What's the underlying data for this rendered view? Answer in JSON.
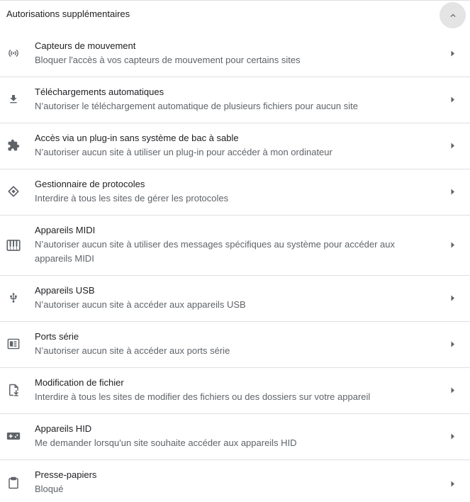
{
  "section": {
    "title": "Autorisations supplémentaires",
    "collapse_icon": "chevron-up-icon"
  },
  "rows": [
    {
      "icon": "sensors-icon",
      "title": "Capteurs de mouvement",
      "subtitle": "Bloquer l'accès à vos capteurs de mouvement pour certains sites"
    },
    {
      "icon": "download-icon",
      "title": "Téléchargements automatiques",
      "subtitle": "N’autoriser le téléchargement automatique de plusieurs fichiers pour aucun site"
    },
    {
      "icon": "extension-icon",
      "title": "Accès via un plug-in sans système de bac à sable",
      "subtitle": "N’autoriser aucun site à utiliser un plug-in pour accéder à mon ordinateur"
    },
    {
      "icon": "protocol-handler-icon",
      "title": "Gestionnaire de protocoles",
      "subtitle": "Interdire à tous les sites de gérer les protocoles"
    },
    {
      "icon": "piano-icon",
      "title": "Appareils MIDI",
      "subtitle": "N’autoriser aucun site à utiliser des messages spécifiques au système pour accéder aux appareils MIDI"
    },
    {
      "icon": "usb-icon",
      "title": "Appareils USB",
      "subtitle": "N’autoriser aucun site à accéder aux appareils USB"
    },
    {
      "icon": "serial-port-icon",
      "title": "Ports série",
      "subtitle": "N’autoriser aucun site à accéder aux ports série"
    },
    {
      "icon": "file-edit-icon",
      "title": "Modification de fichier",
      "subtitle": "Interdire à tous les sites de modifier des fichiers ou des dossiers sur votre appareil"
    },
    {
      "icon": "gamepad-icon",
      "title": "Appareils HID",
      "subtitle": "Me demander lorsqu'un site souhaite accéder aux appareils HID"
    },
    {
      "icon": "clipboard-icon",
      "title": "Presse-papiers",
      "subtitle": "Bloqué"
    }
  ],
  "colors": {
    "title_text": "#202124",
    "secondary_text": "#5f6368",
    "icon": "#5f6368",
    "divider": "#e0e0e0",
    "collapse_button_bg": "#e4e4e4"
  }
}
